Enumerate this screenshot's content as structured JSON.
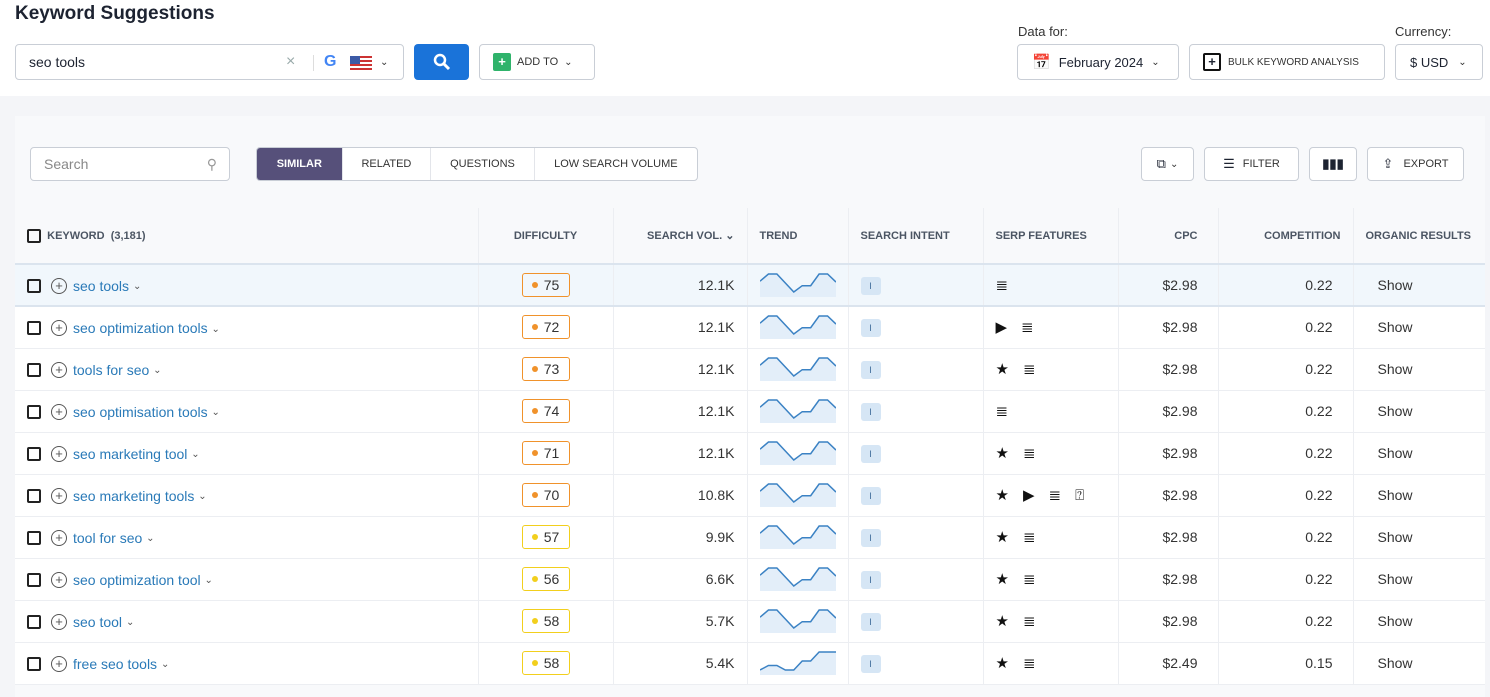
{
  "header": {
    "title": "Keyword Suggestions",
    "query": "seo tools",
    "add_to": "ADD TO",
    "data_for_label": "Data for:",
    "date": "February 2024",
    "bulk": "BULK KEYWORD ANALYSIS",
    "currency_label": "Currency:",
    "currency": "$ USD"
  },
  "toolbar": {
    "search_placeholder": "Search",
    "tabs": [
      "SIMILAR",
      "RELATED",
      "QUESTIONS",
      "LOW SEARCH VOLUME"
    ],
    "active_tab": "SIMILAR",
    "filter": "FILTER",
    "export": "EXPORT"
  },
  "columns": {
    "keyword": "KEYWORD",
    "keyword_count": "(3,181)",
    "difficulty": "DIFFICULTY",
    "volume": "SEARCH VOL.",
    "trend": "TREND",
    "intent": "SEARCH INTENT",
    "serp": "SERP FEATURES",
    "cpc": "CPC",
    "competition": "COMPETITION",
    "organic": "ORGANIC RESULTS"
  },
  "colors": {
    "orange": "#f0922b",
    "yellow": "#f2cf1d",
    "link": "#2a7ab8",
    "primary": "#1a73d9",
    "tab_active": "#56507a"
  },
  "rows": [
    {
      "keyword": "seo tools",
      "difficulty": "75",
      "level": "orange",
      "volume": "12.1K",
      "intent": "I",
      "serp": [
        "list-icon"
      ],
      "cpc": "$2.98",
      "competition": "0.22",
      "organic": "Show",
      "trend": [
        0.6,
        1,
        1,
        0.5,
        0,
        0.35,
        0.35,
        1,
        1,
        0.55
      ]
    },
    {
      "keyword": "seo optimization tools",
      "difficulty": "72",
      "level": "orange",
      "volume": "12.1K",
      "intent": "I",
      "serp": [
        "video-icon",
        "list-icon"
      ],
      "cpc": "$2.98",
      "competition": "0.22",
      "organic": "Show",
      "trend": [
        0.6,
        1,
        1,
        0.5,
        0,
        0.35,
        0.35,
        1,
        1,
        0.55
      ]
    },
    {
      "keyword": "tools for seo",
      "difficulty": "73",
      "level": "orange",
      "volume": "12.1K",
      "intent": "I",
      "serp": [
        "star-icon",
        "list-icon"
      ],
      "cpc": "$2.98",
      "competition": "0.22",
      "organic": "Show",
      "trend": [
        0.6,
        1,
        1,
        0.5,
        0,
        0.35,
        0.35,
        1,
        1,
        0.55
      ]
    },
    {
      "keyword": "seo optimisation tools",
      "difficulty": "74",
      "level": "orange",
      "volume": "12.1K",
      "intent": "I",
      "serp": [
        "list-icon"
      ],
      "cpc": "$2.98",
      "competition": "0.22",
      "organic": "Show",
      "trend": [
        0.6,
        1,
        1,
        0.5,
        0,
        0.35,
        0.35,
        1,
        1,
        0.55
      ]
    },
    {
      "keyword": "seo marketing tool",
      "difficulty": "71",
      "level": "orange",
      "volume": "12.1K",
      "intent": "I",
      "serp": [
        "star-icon",
        "list-icon"
      ],
      "cpc": "$2.98",
      "competition": "0.22",
      "organic": "Show",
      "trend": [
        0.6,
        1,
        1,
        0.5,
        0,
        0.35,
        0.35,
        1,
        1,
        0.55
      ]
    },
    {
      "keyword": "seo marketing tools",
      "difficulty": "70",
      "level": "orange",
      "volume": "10.8K",
      "intent": "I",
      "serp": [
        "star-icon",
        "video-icon",
        "list-icon",
        "question-icon"
      ],
      "cpc": "$2.98",
      "competition": "0.22",
      "organic": "Show",
      "trend": [
        0.6,
        1,
        1,
        0.5,
        0,
        0.35,
        0.35,
        1,
        1,
        0.55
      ]
    },
    {
      "keyword": "tool for seo",
      "difficulty": "57",
      "level": "yellow",
      "volume": "9.9K",
      "intent": "I",
      "serp": [
        "star-icon",
        "list-icon"
      ],
      "cpc": "$2.98",
      "competition": "0.22",
      "organic": "Show",
      "trend": [
        0.6,
        1,
        1,
        0.5,
        0,
        0.35,
        0.35,
        1,
        1,
        0.55
      ]
    },
    {
      "keyword": "seo optimization tool",
      "difficulty": "56",
      "level": "yellow",
      "volume": "6.6K",
      "intent": "I",
      "serp": [
        "star-icon",
        "list-icon"
      ],
      "cpc": "$2.98",
      "competition": "0.22",
      "organic": "Show",
      "trend": [
        0.6,
        1,
        1,
        0.5,
        0,
        0.35,
        0.35,
        1,
        1,
        0.55
      ]
    },
    {
      "keyword": "seo tool",
      "difficulty": "58",
      "level": "yellow",
      "volume": "5.7K",
      "intent": "I",
      "serp": [
        "star-icon",
        "list-icon"
      ],
      "cpc": "$2.98",
      "competition": "0.22",
      "organic": "Show",
      "trend": [
        0.6,
        1,
        1,
        0.5,
        0,
        0.35,
        0.35,
        1,
        1,
        0.55
      ]
    },
    {
      "keyword": "free seo tools",
      "difficulty": "58",
      "level": "yellow",
      "volume": "5.4K",
      "intent": "I",
      "serp": [
        "star-icon",
        "list-icon"
      ],
      "cpc": "$2.49",
      "competition": "0.15",
      "organic": "Show",
      "trend": [
        0,
        0.25,
        0.25,
        0,
        0,
        0.5,
        0.5,
        1,
        1,
        1
      ]
    }
  ]
}
